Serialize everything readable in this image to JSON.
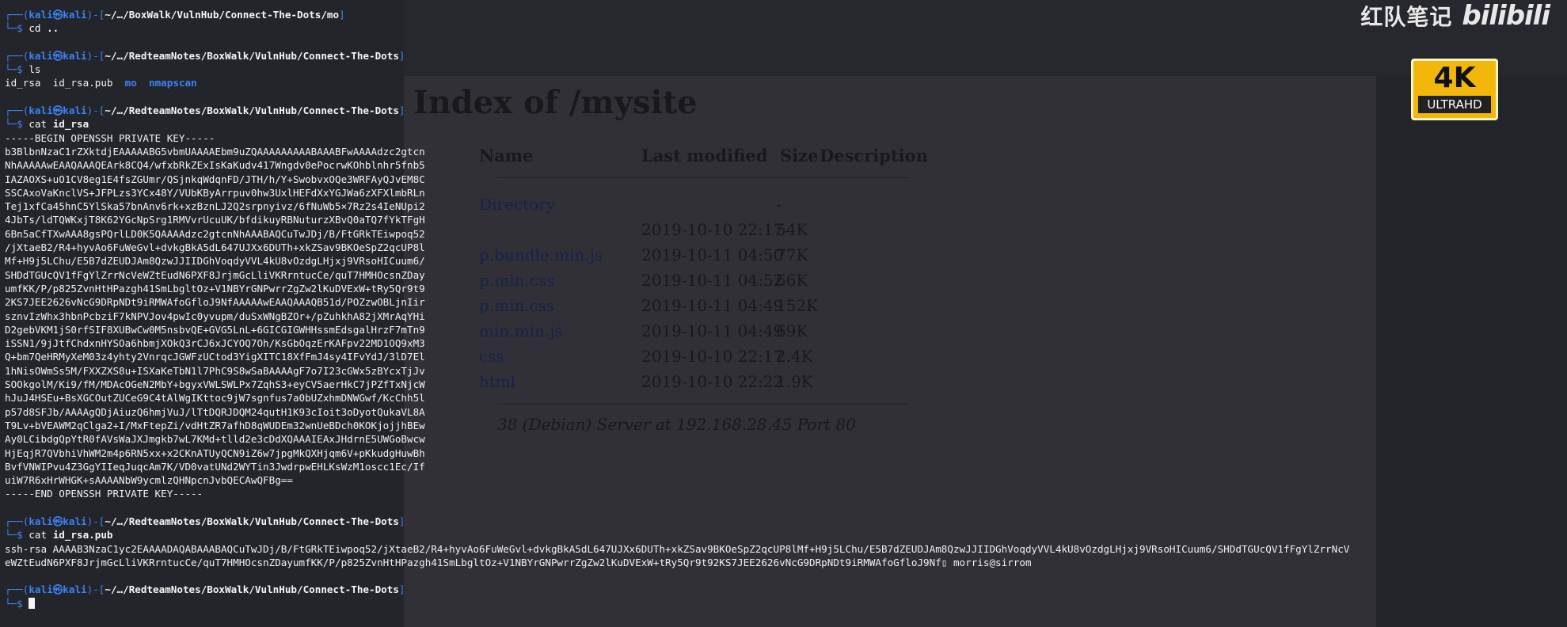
{
  "background_browser": {
    "title": "Index of /mysite",
    "headers": [
      "Name",
      "Last modified",
      "Size",
      "Description"
    ],
    "rows": [
      {
        "name": "Directory",
        "modified": "",
        "size": "-"
      },
      {
        "name": "",
        "modified": "2019-10-10 22:17",
        "size": "54K"
      },
      {
        "name": "p.bundle.min.js",
        "modified": "2019-10-11 04:50",
        "size": "77K"
      },
      {
        "name": "p.min.css",
        "modified": "2019-10-11 04:52",
        "size": "66K"
      },
      {
        "name": "p.min.css",
        "modified": "2019-10-11 04:49",
        "size": "152K"
      },
      {
        "name": "min.min.js",
        "modified": "2019-10-11 04:49",
        "size": "69K"
      },
      {
        "name": "css",
        "modified": "2019-10-10 22:17",
        "size": "2.4K"
      },
      {
        "name": "html",
        "modified": "2019-10-10 22:22",
        "size": "1.9K"
      }
    ],
    "footer": "38 (Debian) Server at 192.168.28.45 Port 80"
  },
  "watermark": {
    "text": "红队笔记",
    "logo": "bilibili",
    "badge_top": "4K",
    "badge_bottom": "ULTRAHD"
  },
  "terminal": {
    "prompt_user": "kali",
    "prompt_at": "㉿",
    "prompt_host": "kali",
    "blocks": [
      {
        "path": "~/…/BoxWalk/VulnHub/Connect-The-Dots/mo",
        "command": "cd",
        "arg": "..",
        "output": []
      },
      {
        "path": "~/…/RedteamNotes/BoxWalk/VulnHub/Connect-The-Dots",
        "command": "ls",
        "arg": "",
        "output": []
      },
      {
        "path": "~/…/RedteamNotes/BoxWalk/VulnHub/Connect-The-Dots",
        "command": "cat",
        "arg": "id_rsa",
        "output": [
          "-----BEGIN OPENSSH PRIVATE KEY-----",
          "b3BlbnNzaC1rZXktdjEAAAAABG5vbmUAAAAEbm9uZQAAAAAAAAABAAABFwAAAAdzc2gtcn",
          "NhAAAAAwEAAQAAAQEArk8CQ4/wfxbRkZExIsKaKudv417Wngdv0ePocrwKOhblnhr5fnb5",
          "IAZAOXS+uO1CV8eg1E4fsZGUmr/QSjnkqWdqnFD/JTH/h/Y+SwobvxOQe3WRFAyQJvEM8C",
          "SSCAxoVaKnclVS+JFPLzs3YCx48Y/VUbKByArrpuv0hw3UxlHEFdXxYGJWa6zXFXlmbRLn",
          "Tej1xfCa45hnC5YlSka57bnAnv6rk+xzBznLJ2Q2srpnyivz/6fNuWb5×7Rz2s4IeNUpi2",
          "4JbTs/ldTQWKxjT8K62YGcNpSrg1RMVvrUcuUK/bfdikuyRBNuturzXBvQ0aTQ7fYkTFgH",
          "6Bn5aCfTXwAAA8gsPQrlLD0K5QAAAAdzc2gtcnNhAAABAQCuTwJDj/B/FtGRkTEiwpoq52",
          "/jXtaeB2/R4+hyvAo6FuWeGvl+dvkgBkA5dL647UJXx6DUTh+xkZSav9BKOeSpZ2qcUP8l",
          "Mf+H9j5LChu/E5B7dZEUDJAm8QzwJJIIDGhVoqdyVVL4kU8vOzdgLHjxj9VRsoHICuum6/",
          "SHDdTGUcQV1fFgYlZrrNcVeWZtEudN6PXF8JrjmGcLliVKRrntucCe/quT7HMHOcsnZDay",
          "umfKK/P/p825ZvnHtHPazgh41SmLbgltOz+V1NBYrGNPwrrZgZw2lKuDVExW+tRy5Qr9t9",
          "2KS7JEE2626vNcG9DRpNDt9iRMWAfoGfloJ9NfAAAAAwEAAQAAAQB51d/POZzwOBLjnIir",
          "sznvIzWhx3hbnPcbziF7kNPVJov4pwIc0yvupm/duSxWNgBZOr+/pZuhkhA82jXMrAqYHi",
          "D2gebVKM1jS0rfSIF8XUBwCw0M5nsbvQE+GVG5LnL+6GICGIGWHHssmEdsgalHrzF7mTn9",
          "iSSN1/9jJtfChdxnHYSOa6hbmjXOkQ3rCJ6xJCYOQ7Oh/KsGbOqzErKAFpv22MD1OQ9xM3",
          "Q+bm7QeHRMyXeM03z4yhty2VnrqcJGWFzUCtod3YigXITC18XfFmJ4sy4IFvYdJ/3lD7El",
          "1hNisOWmSs5M/FXXZXS8u+ISXaKeTbN1l7PhC9S8wSaBAAAAgF7o7I23cGWx5zBYcxTjJv",
          "SOOkgolM/Ki9/fM/MDAcOGeN2MbY+bgyxVWLSWLPx7ZqhS3+eyCV5aerHkC7jPZfTxNjcW",
          "hJuJ4HSEu+BsXGCOutZUCeG9C4tAlWgIKttoc9jW7sgnfus7a0bUZxhmDNWGwf/KcChh5l",
          "p57d8SFJb/AAAAgQDjAiuzQ6hmjVuJ/lTtDQRJDQM24qutH1K93cIoit3oDyotQukaVL8A",
          "T9Lv+bVEAWM2qClga2+I/MxFtepZi/vdHtZR7afhD8qWUDEm32wnUeBDch0KOKjojjhBEw",
          "Ay0LCibdgQpYtR0fAVsWaJXJmgkb7wL7KMd+tlld2e3cDdXQAAAIEAxJHdrnE5UWGoBwcw",
          "HjEqjR7QVbhiVhWM2m4p6RN5xx+x2CKnATUyQCN9iZ6w7jpgMkQXHjqm6V+pKkudgHuwBh",
          "BvfVNWIPvu4Z3GgYIIeqJuqcAm7K/VD0vatUNd2WYTin3JwdrpwEHLKsWzM1oscc1Ec/If",
          "uiW7R6xHrWHGK+sAAAANbW9ycmlzQHNpcnJvbQECAwQFBg==",
          "-----END OPENSSH PRIVATE KEY-----",
          ""
        ]
      },
      {
        "path": "~/…/RedteamNotes/BoxWalk/VulnHub/Connect-The-Dots",
        "command": "cat",
        "arg": "id_rsa.pub",
        "output": [
          "ssh-rsa AAAAB3NzaC1yc2EAAAADAQABAAABAQCuTwJDj/B/FtGRkTEiwpoq52/jXtaeB2/R4+hyvAo6FuWeGvl+dvkgBkA5dL647UJXx6DUTh+xkZSav9BKOeSpZ2qcUP8lMf+H9j5LChu/E5B7dZEUDJAm8QzwJJIIDGhVoqdyVVL4kU8vOzdgLHjxj9VRsoHICuum6/SHDdTGUcQV1fFgYlZrrNcV",
          "eWZtEudN6PXF8JrjmGcLliVKRrntucCe/quT7HMHOcsnZDayumfKK/P/p825ZvnHtHPazgh41SmLbgltOz+V1NBYrGNPwrrZgZw2lKuDVExW+tRy5Qr9t92KS7JEE2626vNcG9DRpNDt9iRMWAfoGfloJ9Nf▯ morris@sirrom",
          ""
        ]
      },
      {
        "path": "~/…/RedteamNotes/BoxWalk/VulnHub/Connect-The-Dots",
        "command": "",
        "arg": "",
        "output": []
      }
    ],
    "ls_output": {
      "files": [
        "id_rsa",
        "id_rsa.pub"
      ],
      "dirs": [
        "mo",
        "nmapscan"
      ]
    }
  }
}
